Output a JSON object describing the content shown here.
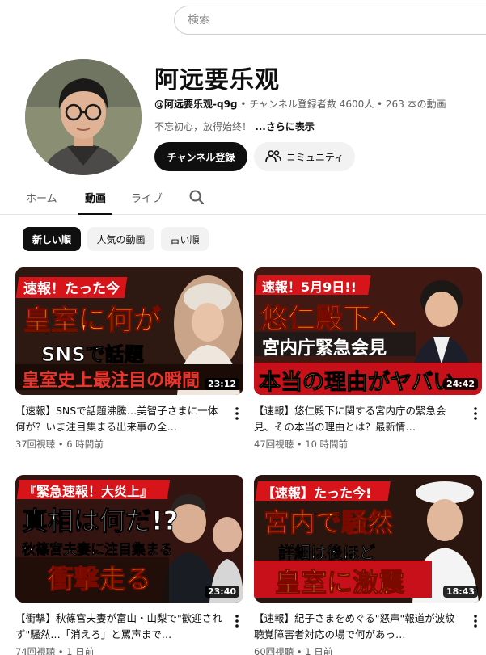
{
  "search": {
    "placeholder": "検索"
  },
  "channel": {
    "name": "阿远要乐观",
    "handle": "@阿远要乐观-q9g",
    "stats": " • チャンネル登録者数 4600人 • 263 本の動画",
    "description": "不忘初心，放得始终！",
    "more_label": " ...さらに表示",
    "subscribe_label": "チャンネル登録",
    "community_label": "コミュニティ"
  },
  "tabs": [
    {
      "label": "ホーム"
    },
    {
      "label": "動画"
    },
    {
      "label": "ライブ"
    }
  ],
  "chips": [
    {
      "label": "新しい順"
    },
    {
      "label": "人気の動画"
    },
    {
      "label": "古い順"
    }
  ],
  "videos": [
    {
      "title": "【速報】SNSで話題沸騰…美智子さまに一体何が？いま注目集まる出来事の全…",
      "views": "37回視聴",
      "age": "6 時間前",
      "duration": "23:12",
      "thumb_text": [
        "速報！たった今",
        "皇室に何が",
        "SNSで話題",
        "皇室史上最注目の瞬間"
      ]
    },
    {
      "title": "【速報】悠仁殿下に関する宮内庁の緊急会見、その本当の理由とは？最新情…",
      "views": "47回視聴",
      "age": "10 時間前",
      "duration": "24:42",
      "thumb_text": [
        "速報！5月9日!!",
        "悠仁殿下へ",
        "宮内庁緊急会見",
        "本当の理由がヤバい"
      ]
    },
    {
      "title": "【衝撃】秋篠宮夫妻が富山・山梨で\"歓迎されず\"騒然…「消えろ」と罵声まで…",
      "views": "74回視聴",
      "age": "1 日前",
      "duration": "23:40",
      "thumb_text": [
        "『緊急速報！大炎上』",
        "真相は何だ!?",
        "秋篠宮夫妻に注目集まる",
        "衝撃走る"
      ]
    },
    {
      "title": "【速報】紀子さまをめぐる\"怒声\"報道が波紋　聴覚障害者対応の場で何があっ…",
      "views": "60回視聴",
      "age": "1 日前",
      "duration": "18:43",
      "thumb_text": [
        "【速報】たった今!",
        "宮内で騒然",
        "詳細は後ほど",
        "皇室に激震"
      ]
    }
  ],
  "colors": {
    "accent_red": "#d7141a",
    "banner_red": "#c8101a",
    "dark": "#0f0f0f",
    "muted": "#606060"
  }
}
